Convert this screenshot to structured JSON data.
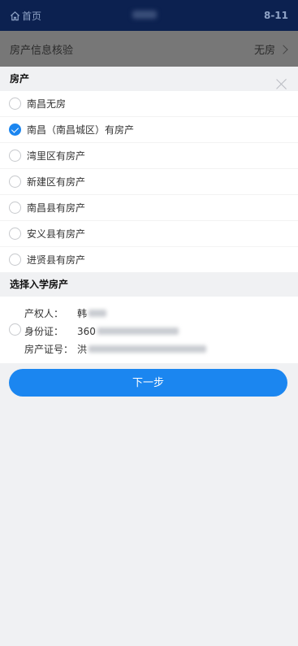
{
  "header": {
    "home_label": "首页",
    "date": "8-11"
  },
  "verify_row": {
    "label": "房产信息核验",
    "value": "无房"
  },
  "property_section": {
    "title": "房产",
    "options": [
      {
        "label": "南昌无房",
        "checked": false
      },
      {
        "label": "南昌（南昌城区）有房产",
        "checked": true
      },
      {
        "label": "湾里区有房产",
        "checked": false
      },
      {
        "label": "新建区有房产",
        "checked": false
      },
      {
        "label": "南昌县有房产",
        "checked": false
      },
      {
        "label": "安义县有房产",
        "checked": false
      },
      {
        "label": "进贤县有房产",
        "checked": false
      }
    ]
  },
  "enrollment_section": {
    "title": "选择入学房产",
    "owner_label": "产权人：",
    "owner_value": "韩",
    "id_label": "身份证：",
    "id_value": "360",
    "cert_label": "房产证号：",
    "cert_value": "洪"
  },
  "next_button": "下一步",
  "colors": {
    "primary": "#1b86f0",
    "header_bg": "#0c2150"
  }
}
